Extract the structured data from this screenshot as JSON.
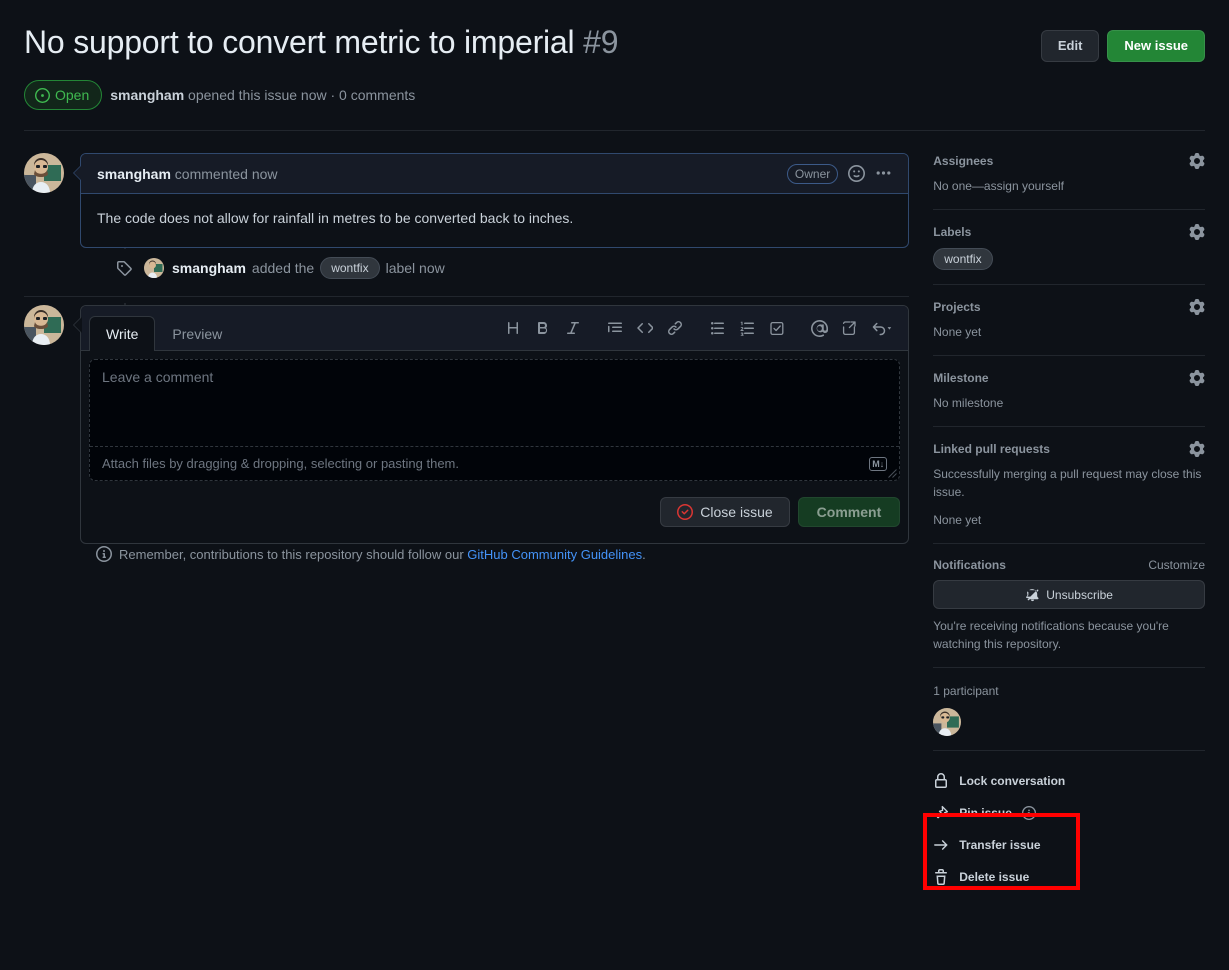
{
  "header": {
    "title": "No support to convert metric to imperial",
    "issue_number": "#9",
    "edit_label": "Edit",
    "new_issue_label": "New issue",
    "state": "Open",
    "meta_author": "smangham",
    "meta_text": " opened this issue now · 0 comments"
  },
  "comment": {
    "author": "smangham",
    "action": " commented now",
    "owner_badge": "Owner",
    "body": "The code does not allow for rainfall in metres to be converted back to inches."
  },
  "event": {
    "author": "smangham",
    "verb": "added the",
    "label": "wontfix",
    "suffix": "label now"
  },
  "composer": {
    "tab_write": "Write",
    "tab_preview": "Preview",
    "placeholder": "Leave a comment",
    "attach_text": "Attach files by dragging & dropping, selecting or pasting them.",
    "markdown_badge": "M↓",
    "close_issue_label": "Close issue",
    "comment_label": "Comment",
    "guideline_prefix": "Remember, contributions to this repository should follow our ",
    "guideline_link": "GitHub Community Guidelines",
    "guideline_suffix": "."
  },
  "sidebar": {
    "assignees": {
      "title": "Assignees",
      "empty": "No one—assign yourself"
    },
    "labels": {
      "title": "Labels",
      "chip": "wontfix"
    },
    "projects": {
      "title": "Projects",
      "empty": "None yet"
    },
    "milestone": {
      "title": "Milestone",
      "empty": "No milestone"
    },
    "linked_prs": {
      "title": "Linked pull requests",
      "hint": "Successfully merging a pull request may close this issue.",
      "empty": "None yet"
    },
    "notifications": {
      "title": "Notifications",
      "customize": "Customize",
      "button": "Unsubscribe",
      "hint": "You're receiving notifications because you're watching this repository."
    },
    "participants": {
      "title": "1 participant"
    },
    "actions": {
      "lock": "Lock conversation",
      "pin": "Pin issue",
      "transfer": "Transfer issue",
      "delete": "Delete issue"
    }
  },
  "colors": {
    "accent_green": "#238636",
    "open_green": "#3fb950",
    "link_blue": "#4493f8",
    "annotation_red": "#ff0000"
  }
}
